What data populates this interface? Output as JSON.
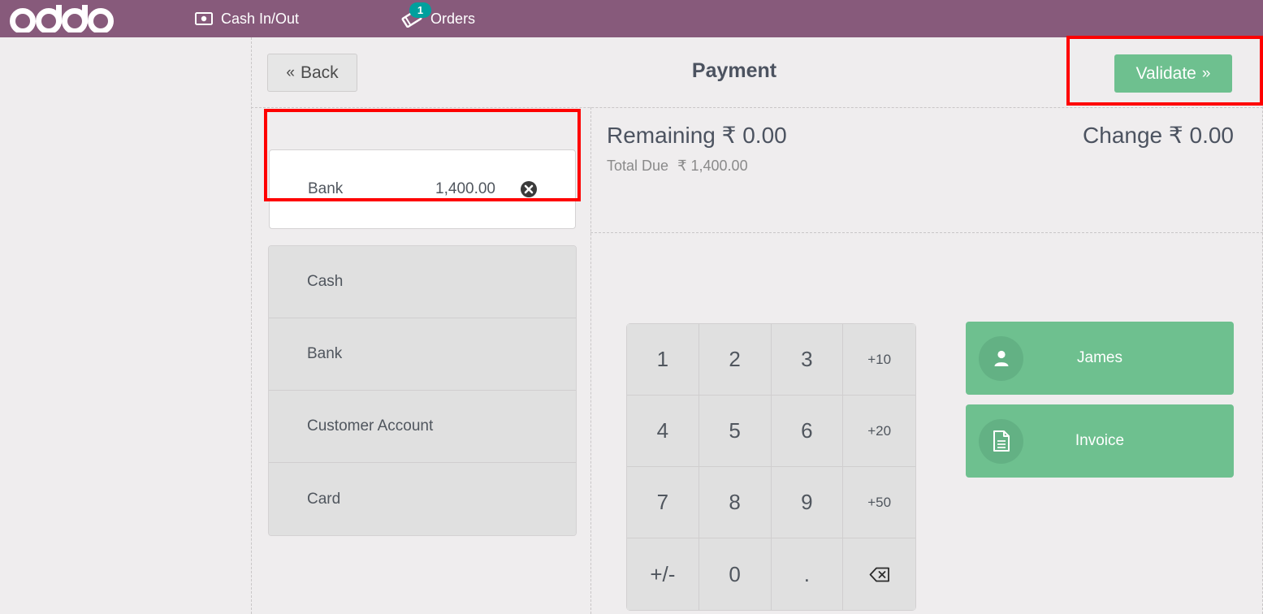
{
  "topbar": {
    "logo_text": "odoo",
    "items": [
      {
        "label": "Cash In/Out",
        "icon": "banknote-icon"
      },
      {
        "label": "Orders",
        "icon": "receipt-ticket-icon",
        "badge": "1"
      }
    ]
  },
  "header": {
    "back_label": "Back",
    "back_chevron": "«",
    "title": "Payment",
    "validate_label": "Validate",
    "validate_chevron": "»"
  },
  "payment_lines": [
    {
      "name": "Bank",
      "amount": "1,400.00",
      "delete_icon": "delete-circle-icon"
    }
  ],
  "payment_methods": [
    {
      "label": "Cash"
    },
    {
      "label": "Bank"
    },
    {
      "label": "Customer Account"
    },
    {
      "label": "Card"
    }
  ],
  "totals": {
    "remaining_label": "Remaining",
    "remaining_value": "₹ 0.00",
    "total_due_label": "Total Due",
    "total_due_value": "₹ 1,400.00",
    "change_label": "Change",
    "change_value": "₹ 0.00"
  },
  "numpad": {
    "keys": [
      {
        "label": "1",
        "type": "digit"
      },
      {
        "label": "2",
        "type": "digit"
      },
      {
        "label": "3",
        "type": "digit"
      },
      {
        "label": "+10",
        "type": "shortcut"
      },
      {
        "label": "4",
        "type": "digit"
      },
      {
        "label": "5",
        "type": "digit"
      },
      {
        "label": "6",
        "type": "digit"
      },
      {
        "label": "+20",
        "type": "shortcut"
      },
      {
        "label": "7",
        "type": "digit"
      },
      {
        "label": "8",
        "type": "digit"
      },
      {
        "label": "9",
        "type": "digit"
      },
      {
        "label": "+50",
        "type": "shortcut"
      },
      {
        "label": "+/-",
        "type": "sign"
      },
      {
        "label": "0",
        "type": "digit"
      },
      {
        "label": ".",
        "type": "decimal"
      },
      {
        "label": "",
        "type": "backspace",
        "icon": "backspace-icon"
      }
    ]
  },
  "side_actions": [
    {
      "label": "James",
      "icon": "customer-person-icon"
    },
    {
      "label": "Invoice",
      "icon": "invoice-document-icon"
    }
  ],
  "colors": {
    "brand_purple": "#875a7b",
    "accent_green": "#6ec08f",
    "badge_teal": "#00a09d",
    "annotation_red": "#fe0000",
    "page_background": "#efedee"
  }
}
